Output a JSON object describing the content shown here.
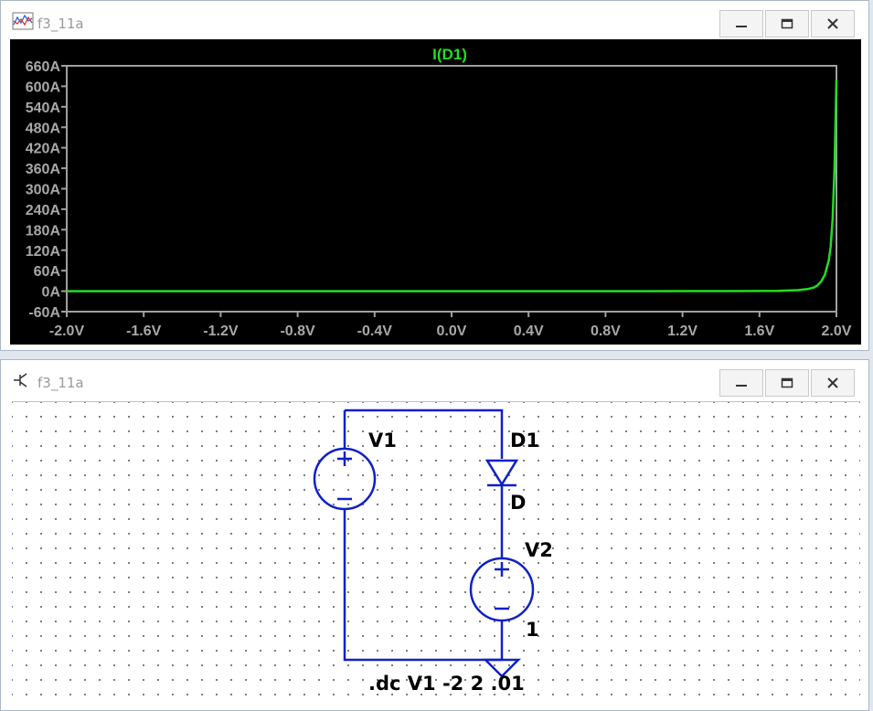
{
  "waveform_window": {
    "title": "f3_11a",
    "trace_label": "I(D1)",
    "trace_color": "#22dd22"
  },
  "schematic_window": {
    "title": "f3_11a",
    "components": {
      "v1_name": "V1",
      "d1_name": "D1",
      "d1_model": "D",
      "v2_name": "V2",
      "v2_value": "1"
    },
    "directive": ".dc V1 -2 2 .01",
    "wire_color": "#1020c8"
  },
  "window_buttons": [
    "minimize-icon",
    "maximize-icon",
    "close-icon"
  ],
  "chart_data": {
    "type": "line",
    "title": "I(D1)",
    "xlabel": "",
    "ylabel": "",
    "xlim": [
      -2.0,
      2.0
    ],
    "ylim": [
      -60,
      660
    ],
    "x_ticks": [
      "-2.0V",
      "-1.6V",
      "-1.2V",
      "-0.8V",
      "-0.4V",
      "0.0V",
      "0.4V",
      "0.8V",
      "1.2V",
      "1.6V",
      "2.0V"
    ],
    "y_ticks": [
      "660A",
      "600A",
      "540A",
      "480A",
      "420A",
      "360A",
      "300A",
      "240A",
      "180A",
      "120A",
      "60A",
      "0A",
      "-60A"
    ],
    "grid": false,
    "series": [
      {
        "name": "I(D1)",
        "color": "#22dd22",
        "x": [
          -2.0,
          -1.0,
          0.0,
          1.0,
          1.5,
          1.7,
          1.8,
          1.85,
          1.88,
          1.9,
          1.92,
          1.94,
          1.96,
          1.97,
          1.98,
          1.99,
          2.0
        ],
        "y": [
          0,
          0,
          0,
          0,
          0.2,
          1,
          3,
          6,
          10,
          16,
          28,
          48,
          90,
          130,
          210,
          360,
          620
        ]
      }
    ]
  }
}
